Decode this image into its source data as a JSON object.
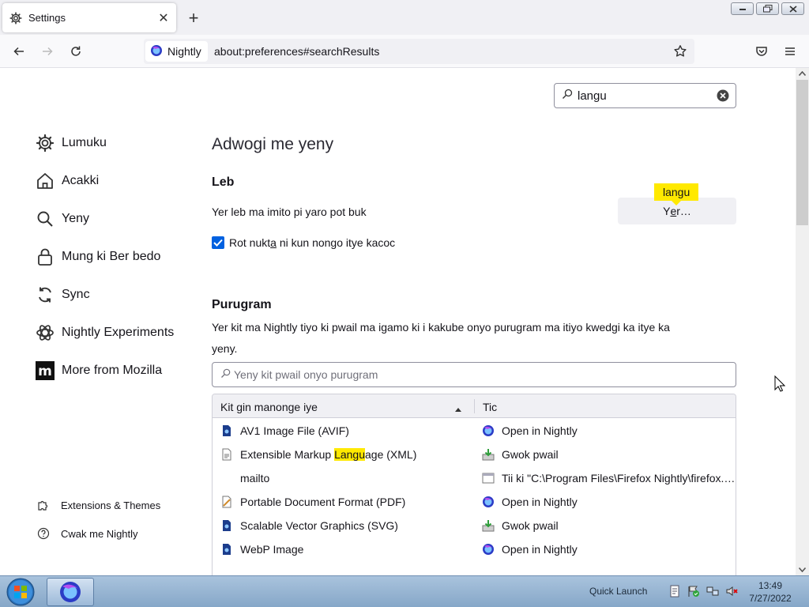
{
  "tab": {
    "title": "Settings",
    "close": "✕",
    "new": "+"
  },
  "nav": {
    "identity_label": "Nightly",
    "url": "about:preferences#searchResults"
  },
  "search": {
    "query": "langu"
  },
  "sidebar": {
    "items": [
      {
        "label": "Lumuku",
        "icon": "gear-icon"
      },
      {
        "label": "Acakki",
        "icon": "home-icon"
      },
      {
        "label": "Yeny",
        "icon": "search-icon"
      },
      {
        "label": "Mung ki Ber bedo",
        "icon": "lock-icon"
      },
      {
        "label": "Sync",
        "icon": "sync-icon"
      },
      {
        "label": "Nightly Experiments",
        "icon": "flask-icon"
      },
      {
        "label": "More from Mozilla",
        "icon": "mozilla-logo-icon"
      }
    ],
    "footer": [
      {
        "label": "Extensions & Themes",
        "icon": "puzzle-icon"
      },
      {
        "label": "Cwak me Nightly",
        "icon": "help-icon"
      }
    ]
  },
  "main": {
    "heading": "Adwogi me yeny",
    "lang_title": "Leb",
    "lang_text": "Yer leb ma imito pi yaro pot buk",
    "choose_btn_pre": "Y",
    "choose_btn_ul": "e",
    "choose_btn_post": "r…",
    "tooltip": "langu",
    "spell_pre": "Rot nukt",
    "spell_ul": "a",
    "spell_post": " ni kun nongo itye kacoc",
    "spell_checked": true,
    "apps_title": "Purugram",
    "apps_desc_1": "Yer kit ma Nightly tiyo ki pwail ma igamo ki i kakube onyo purugram ma itiyo kwedgi ka itye ka",
    "apps_desc_2": "yeny.",
    "filter_placeholder": "Yeny kit pwail onyo purugram",
    "col_type": "Kit gin manonge iye",
    "col_action": "Tic",
    "rows": [
      {
        "type_pre": "AV1 Image File (AVIF)",
        "type_hl": "",
        "type_post": "",
        "action": "Open in Nightly",
        "type_icon": "image-file-icon",
        "action_icon": "nightly-icon"
      },
      {
        "type_pre": "Extensible Markup ",
        "type_hl": "Langu",
        "type_post": "age (XML)",
        "action": "Gwok pwail",
        "type_icon": "xml-file-icon",
        "action_icon": "save-file-icon"
      },
      {
        "type_pre": "mailto",
        "type_hl": "",
        "type_post": "",
        "action": "Tii ki \"C:\\Program Files\\Firefox Nightly\\firefox.exe\"",
        "type_icon": "",
        "action_icon": "application-icon"
      },
      {
        "type_pre": "Portable Document Format (PDF)",
        "type_hl": "",
        "type_post": "",
        "action": "Open in Nightly",
        "type_icon": "pdf-file-icon",
        "action_icon": "nightly-icon"
      },
      {
        "type_pre": "Scalable Vector Graphics (SVG)",
        "type_hl": "",
        "type_post": "",
        "action": "Gwok pwail",
        "type_icon": "image-file-icon",
        "action_icon": "save-file-icon"
      },
      {
        "type_pre": "WebP Image",
        "type_hl": "",
        "type_post": "",
        "action": "Open in Nightly",
        "type_icon": "image-file-icon",
        "action_icon": "nightly-icon"
      }
    ]
  },
  "taskbar": {
    "quick_launch": "Quick Launch",
    "time": "13:49",
    "date": "7/27/2022"
  },
  "colors": {
    "accent": "#0061e0",
    "highlight": "#ffe900",
    "tab_strip": "#f0f0f4"
  }
}
